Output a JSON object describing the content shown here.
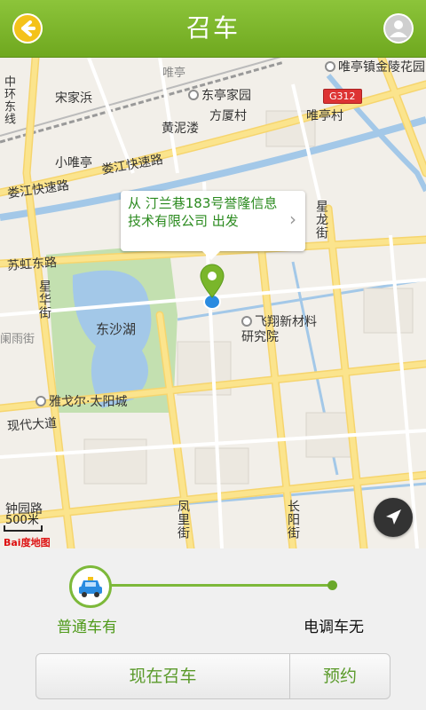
{
  "header": {
    "title": "召车"
  },
  "map": {
    "callout": {
      "text": "从 汀兰巷183号誉隆信息技术有限公司 出发",
      "chevron": "›"
    },
    "labels": {
      "zhonghuan_east": "中环东线",
      "songjiabang": "宋家浜",
      "weiting_small": "唯亭",
      "dongting_home": "东亭家园",
      "weiting_golden": "唯亭镇金陵花园",
      "g312": "G312",
      "fangsha_village": "方厦村",
      "weiting_village": "唯亭村",
      "huangnilou": "黄泥溇",
      "xiaoweiting": "小唯亭",
      "loujiang_express_right": "娄江快速路",
      "loujiang_express_left": "娄江快速路",
      "suhong_east": "苏虹东路",
      "xinglong_street": "星龙街",
      "xinghua_street": "星华街",
      "dongsha_lake": "东沙湖",
      "feixiang": "飞翔新材料研究院",
      "yayu_street": "阑雨街",
      "yageer": "雅戈尔·太阳城",
      "xiandai_avenue": "现代大道",
      "zhongyuan_road": "钟园路",
      "fengli_street": "凤里街",
      "changyang_street": "长阳街"
    },
    "scale": "500米",
    "logo": "Bai度地图"
  },
  "bottom": {
    "option_normal": "普通车有",
    "option_dispatch": "电调车无",
    "call_now": "现在召车",
    "reserve": "预约"
  },
  "colors": {
    "header_green": "#7ab62b",
    "accent_green": "#5a9a2a",
    "pin_green": "#7ab62b",
    "location_blue": "#2a8be0",
    "road_yellow": "#fbe48d",
    "water_blue": "#a3c8e8",
    "park_green": "#c3e0b0"
  },
  "icons": {
    "back": "back-arrow-icon",
    "avatar": "user-avatar-icon",
    "pin": "map-pin-icon",
    "locate": "navigation-arrow-icon",
    "car": "taxi-icon"
  }
}
